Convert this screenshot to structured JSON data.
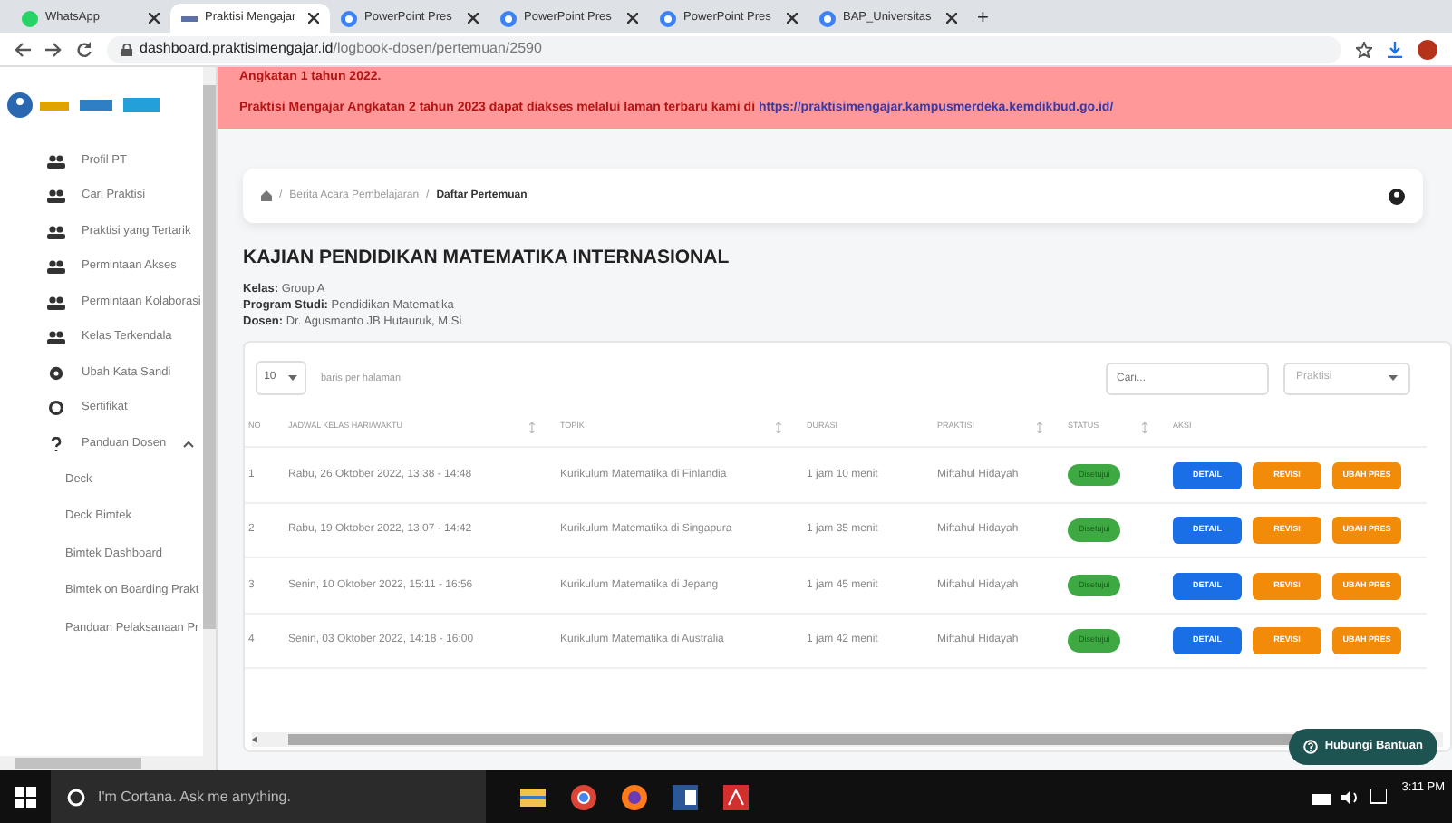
{
  "browser": {
    "tabs": [
      {
        "title": "WhatsApp",
        "selected": false
      },
      {
        "title": "Praktisi Mengajar",
        "selected": true
      },
      {
        "title": "PowerPoint Pres",
        "selected": false
      },
      {
        "title": "PowerPoint Pres",
        "selected": false
      },
      {
        "title": "PowerPoint Pres",
        "selected": false
      },
      {
        "title": "BAP_Universitas",
        "selected": false
      }
    ],
    "new_tab": "+",
    "url_host": "dashboard.praktisimengajar.id",
    "url_path": "/logbook-dosen/pertemuan/2590"
  },
  "banner": {
    "lines": [
      "Angkatan 1 tahun 2022.",
      "Praktisi Mengajar Angkatan 2 tahun 2023 dapat diakses melalui laman terbaru kami di "
    ],
    "link": "https://praktisimengajar.kampusmerdeka.kemdikbud.go.id/"
  },
  "sidebar": {
    "items": [
      {
        "label": "Profil PT",
        "kind": "group"
      },
      {
        "label": "Cari Praktisi",
        "kind": "group"
      },
      {
        "label": "Praktisi yang Tertarik",
        "kind": "group"
      },
      {
        "label": "Permintaan Akses",
        "kind": "group"
      },
      {
        "label": "Permintaan Kolaborasi",
        "kind": "group"
      },
      {
        "label": "Kelas Terkendala",
        "kind": "group"
      },
      {
        "label": "Ubah Kata Sandi",
        "kind": "gear"
      },
      {
        "label": "Sertifikat",
        "kind": "ring"
      },
      {
        "label": "Panduan Dosen",
        "kind": "question",
        "expanded": true,
        "children": [
          {
            "label": "Deck"
          },
          {
            "label": "Deck Bimtek"
          },
          {
            "label": "Bimtek Dashboard"
          },
          {
            "label": "Bimtek on Boarding Prakt"
          },
          {
            "label": "Panduan Pelaksanaan Pr"
          }
        ]
      }
    ]
  },
  "breadcrumb": {
    "separator": "/",
    "items": [
      "Berita Acara Pembelajaran",
      "Daftar Pertemuan"
    ]
  },
  "course": {
    "title": "KAJIAN PENDIDIKAN MATEMATIKA INTERNASIONAL",
    "info": [
      {
        "label": "Kelas:",
        "value": "Group A"
      },
      {
        "label": "Program Studi:",
        "value": "Pendidikan Matematika"
      },
      {
        "label": "Dosen:",
        "value": "Dr. Agusmanto JB Hutauruk, M.Si"
      }
    ]
  },
  "table": {
    "page_size": "10",
    "page_size_label": "baris per halaman",
    "search": {
      "placeholder": "Cari..."
    },
    "filter": {
      "placeholder": "Praktisi"
    },
    "columns": [
      {
        "label": "NO",
        "sortable": false
      },
      {
        "label": "JADWAL KELAS HARI/WAKTU",
        "sortable": true
      },
      {
        "label": "TOPIK",
        "sortable": true
      },
      {
        "label": "DURASI",
        "sortable": false
      },
      {
        "label": "PRAKTISI",
        "sortable": true
      },
      {
        "label": "STATUS",
        "sortable": true
      },
      {
        "label": "AKSI",
        "sortable": false
      }
    ],
    "rows": [
      {
        "no": "1",
        "jadwal": "Rabu, 26 Oktober 2022, 13:38 - 14:48",
        "topik": "Kurikulum Matematika di Finlandia",
        "durasi": "1 jam 10 menit",
        "praktisi": "Miftahul Hidayah",
        "status": "Disetujui",
        "actions": [
          "DETAIL",
          "REVISI",
          "UBAH PRES"
        ]
      },
      {
        "no": "2",
        "jadwal": "Rabu, 19 Oktober 2022, 13:07 - 14:42",
        "topik": "Kurikulum Matematika di Singapura",
        "durasi": "1 jam 35 menit",
        "praktisi": "Miftahul Hidayah",
        "status": "Disetujui",
        "actions": [
          "DETAIL",
          "REVISI",
          "UBAH PRES"
        ]
      },
      {
        "no": "3",
        "jadwal": "Senin, 10 Oktober 2022, 15:11 - 16:56",
        "topik": "Kurikulum Matematika di Jepang",
        "durasi": "1 jam 45 menit",
        "praktisi": "Miftahul Hidayah",
        "status": "Disetujui",
        "actions": [
          "DETAIL",
          "REVISI",
          "UBAH PRES"
        ]
      },
      {
        "no": "4",
        "jadwal": "Senin, 03 Oktober 2022, 14:18 - 16:00",
        "topik": "Kurikulum Matematika di Australia",
        "durasi": "1 jam 42 menit",
        "praktisi": "Miftahul Hidayah",
        "status": "Disetujui",
        "actions": [
          "DETAIL",
          "REVISI",
          "UBAH PRES"
        ]
      }
    ]
  },
  "help_button": "Hubungi Bantuan",
  "taskbar": {
    "search": {
      "placeholder": "I'm Cortana. Ask me anything."
    },
    "time": "3:11 PM"
  }
}
